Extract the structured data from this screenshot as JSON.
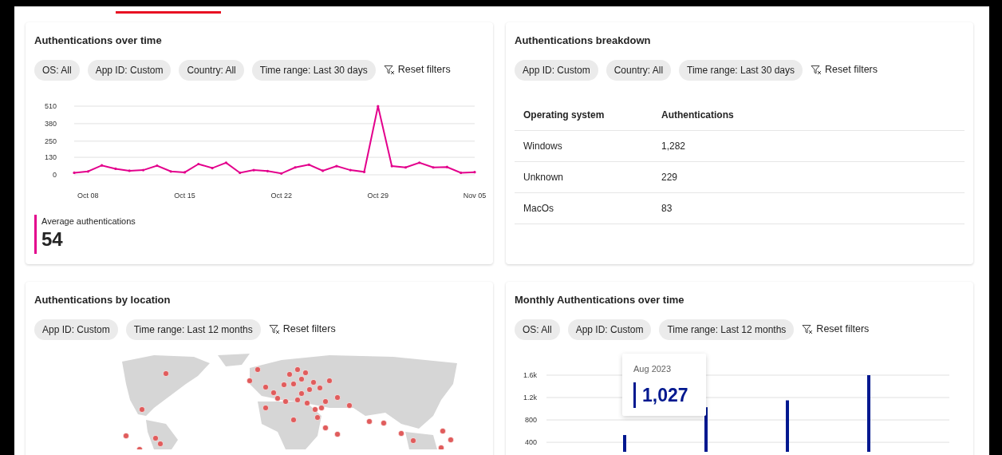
{
  "cards": [
    {
      "kind": "line_chart",
      "title": "Authentications over time",
      "filters": [
        "OS: All",
        "App ID: Custom",
        "Country: All",
        "Time range: Last 30 days"
      ],
      "reset_label": "Reset filters",
      "chart_data": {
        "type": "line",
        "categories": [
          null,
          "Oct 08",
          null,
          null,
          null,
          null,
          null,
          null,
          "Oct 15",
          null,
          null,
          null,
          null,
          null,
          null,
          "Oct 22",
          null,
          null,
          null,
          null,
          null,
          null,
          "Oct 29",
          null,
          null,
          null,
          null,
          null,
          null,
          "Nov 05"
        ],
        "series": [
          {
            "color": "#e3008c",
            "values": [
              15,
              25,
              70,
              45,
              30,
              35,
              68,
              25,
              18,
              80,
              50,
              90,
              15,
              35,
              28,
              10,
              55,
              75,
              30,
              65,
              35,
              22,
              510,
              65,
              55,
              90,
              55,
              58,
              15,
              20
            ]
          }
        ],
        "ylim": [
          0,
          510
        ],
        "yticks": [
          0,
          130,
          250,
          380,
          510
        ],
        "grid": true
      },
      "stat": {
        "label": "Average authentications",
        "value": "54",
        "color": "#e3008c"
      }
    },
    {
      "kind": "table",
      "title": "Authentications breakdown",
      "filters": [
        "App ID: Custom",
        "Country: All",
        "Time range: Last 30 days"
      ],
      "reset_label": "Reset filters",
      "table": {
        "columns": [
          "Operating system",
          "Authentications"
        ],
        "rows": [
          [
            "Windows",
            "1,282"
          ],
          [
            "Unknown",
            "229"
          ],
          [
            "MacOs",
            "83"
          ]
        ]
      }
    },
    {
      "kind": "map",
      "title": "Authentications by location",
      "filters": [
        "App ID: Custom",
        "Time range: Last 12 months"
      ],
      "reset_label": "Reset filters"
    },
    {
      "kind": "bar_chart",
      "title": "Monthly Authentications over time",
      "filters": [
        "OS: All",
        "App ID: Custom",
        "Time range: Last 12 months"
      ],
      "reset_label": "Reset filters",
      "chart_data": {
        "type": "bar",
        "values": [
          530,
          1027,
          1150,
          1600
        ],
        "ylim": [
          230,
          1600
        ],
        "grid": true,
        "yticks": [
          {
            "value": 400,
            "label": "400"
          },
          {
            "value": 800,
            "label": "800"
          },
          {
            "value": 1200,
            "label": "1.2k"
          },
          {
            "value": 1600,
            "label": "1.6k"
          }
        ]
      },
      "tooltip": {
        "label": "Aug 2023",
        "value": "1,027",
        "color": "#00188f"
      }
    }
  ]
}
